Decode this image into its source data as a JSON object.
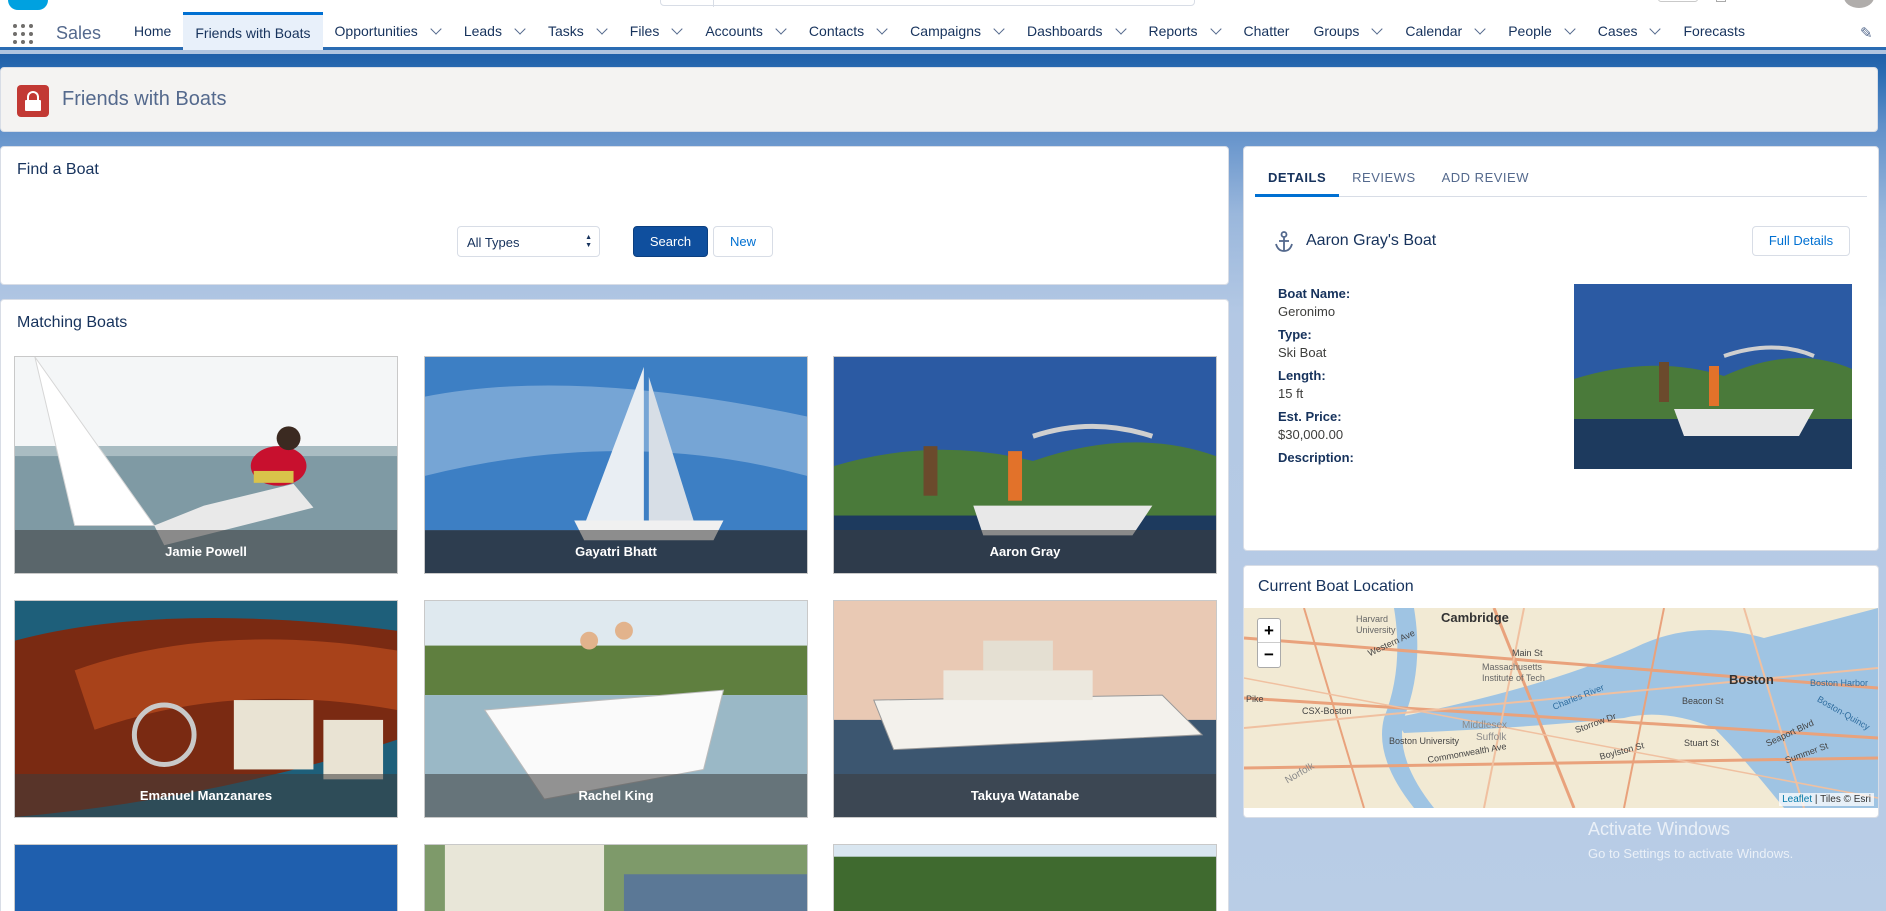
{
  "app": {
    "name": "Sales"
  },
  "nav": {
    "items": [
      {
        "label": "Home",
        "dropdown": false,
        "active": false
      },
      {
        "label": "Friends with Boats",
        "dropdown": false,
        "active": true
      },
      {
        "label": "Opportunities",
        "dropdown": true,
        "active": false
      },
      {
        "label": "Leads",
        "dropdown": true,
        "active": false
      },
      {
        "label": "Tasks",
        "dropdown": true,
        "active": false
      },
      {
        "label": "Files",
        "dropdown": true,
        "active": false
      },
      {
        "label": "Accounts",
        "dropdown": true,
        "active": false
      },
      {
        "label": "Contacts",
        "dropdown": true,
        "active": false
      },
      {
        "label": "Campaigns",
        "dropdown": true,
        "active": false
      },
      {
        "label": "Dashboards",
        "dropdown": true,
        "active": false
      },
      {
        "label": "Reports",
        "dropdown": true,
        "active": false
      },
      {
        "label": "Chatter",
        "dropdown": false,
        "active": false
      },
      {
        "label": "Groups",
        "dropdown": true,
        "active": false
      },
      {
        "label": "Calendar",
        "dropdown": true,
        "active": false
      },
      {
        "label": "People",
        "dropdown": true,
        "active": false
      },
      {
        "label": "Cases",
        "dropdown": true,
        "active": false
      },
      {
        "label": "Forecasts",
        "dropdown": false,
        "active": false
      }
    ]
  },
  "header": {
    "title": "Friends with Boats",
    "icon": "lock-icon",
    "icon_color": "#c23934"
  },
  "find": {
    "title": "Find a Boat",
    "type_select": "All Types",
    "search_label": "Search",
    "new_label": "New"
  },
  "matching": {
    "title": "Matching Boats",
    "boats": [
      {
        "owner": "Jamie Powell"
      },
      {
        "owner": "Gayatri Bhatt"
      },
      {
        "owner": "Aaron Gray"
      },
      {
        "owner": "Emanuel Manzanares"
      },
      {
        "owner": "Rachel King"
      },
      {
        "owner": "Takuya Watanabe"
      },
      {
        "owner": ""
      },
      {
        "owner": ""
      },
      {
        "owner": ""
      }
    ]
  },
  "details": {
    "tabs": [
      "DETAILS",
      "REVIEWS",
      "ADD REVIEW"
    ],
    "heading": "Aaron Gray's Boat",
    "full_details_label": "Full Details",
    "fields": [
      {
        "label": "Boat Name:",
        "value": "Geronimo"
      },
      {
        "label": "Type:",
        "value": "Ski Boat"
      },
      {
        "label": "Length:",
        "value": "15 ft"
      },
      {
        "label": "Est. Price:",
        "value": "$30,000.00"
      },
      {
        "label": "Description:",
        "value": ""
      }
    ]
  },
  "map": {
    "title": "Current Boat Location",
    "zoom_in": "+",
    "zoom_out": "−",
    "attribution_link": "Leaflet",
    "attribution_rest": " | Tiles © Esri",
    "labels": [
      "Cambridge",
      "Boston",
      "Harvard University",
      "Main St",
      "Massachusetts Institute of Tech",
      "Western Ave",
      "Charles River",
      "Beacon St",
      "Boston Harbor",
      "Boston-Quincy",
      "Storrow Dr",
      "Boylston St",
      "Commonwealth Ave",
      "Boston University",
      "Middlesex",
      "Suffolk",
      "Norfolk",
      "Summer St",
      "Seaport Blvd",
      "Stuart St",
      "CSX-Boston",
      "Pike"
    ]
  },
  "watermark": {
    "line1": "Activate Windows",
    "line2": "Go to Settings to activate Windows."
  }
}
